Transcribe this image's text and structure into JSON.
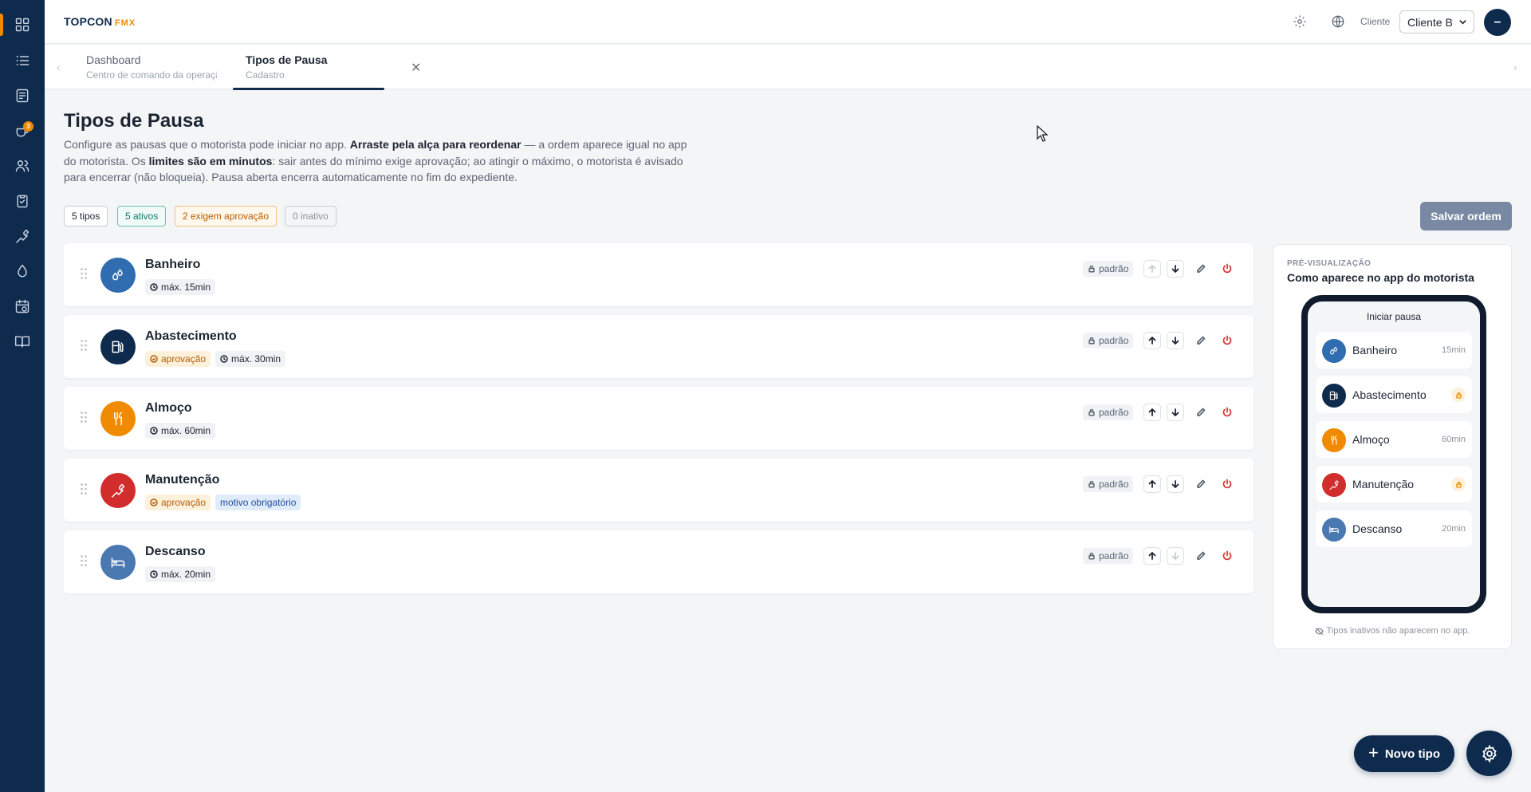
{
  "app": {
    "logo_main": "TOPCON",
    "logo_sub": "FMX",
    "cliente_label": "Cliente",
    "cliente_value": "Cliente B",
    "avatar_initial": "–",
    "sidebar_badge": "3"
  },
  "tabs": [
    {
      "title": "Dashboard",
      "subtitle": "Centro de comando da operaçã"
    },
    {
      "title": "Tipos de Pausa",
      "subtitle": "Cadastro"
    }
  ],
  "page": {
    "title": "Tipos de Pausa",
    "desc_1": "Configure as pausas que o motorista pode iniciar no app. ",
    "desc_2": "Arraste pela alça para reordenar",
    "desc_3": " — a ordem aparece igual no app do motorista. Os ",
    "desc_4": "limites são em minutos",
    "desc_5": ": sair antes do mínimo exige aprovação; ao atingir o máximo, o motorista é avisado para encerrar (não bloqueia). Pausa aberta encerra automaticamente no fim do expediente."
  },
  "chips": {
    "tipos": "5 tipos",
    "ativos": "5 ativos",
    "aprovacao": "2 exigem aprovação",
    "inativo": "0 inativo"
  },
  "save_label": "Salvar ordem",
  "padrao_label": "padrão",
  "rows": [
    {
      "name": "Banheiro",
      "color": "#2f6db0",
      "icon": "droplets-icon",
      "max": "máx. 15min"
    },
    {
      "name": "Abastecimento",
      "color": "#0e2a4d",
      "icon": "fuel-icon",
      "approval": "aprovação",
      "max": "máx. 30min"
    },
    {
      "name": "Almoço",
      "color": "#f08a00",
      "icon": "utensils-icon",
      "max": "máx. 60min"
    },
    {
      "name": "Manutenção",
      "color": "#d12d2d",
      "icon": "wrench-icon",
      "approval": "aprovação",
      "reason": "motivo obrigatório"
    },
    {
      "name": "Descanso",
      "color": "#4a78b0",
      "icon": "bed-icon",
      "max": "máx. 20min"
    }
  ],
  "preview": {
    "kicker": "PRÉ-VISUALIZAÇÃO",
    "title": "Como aparece no app do motorista",
    "phone_title": "Iniciar pausa",
    "items": [
      {
        "name": "Banheiro",
        "duration": "15min"
      },
      {
        "name": "Abastecimento",
        "locked": true
      },
      {
        "name": "Almoço",
        "duration": "60min"
      },
      {
        "name": "Manutenção",
        "locked": true
      },
      {
        "name": "Descanso",
        "duration": "20min"
      }
    ],
    "note": "Tipos inativos não aparecem no app."
  },
  "new_button": "Novo tipo"
}
